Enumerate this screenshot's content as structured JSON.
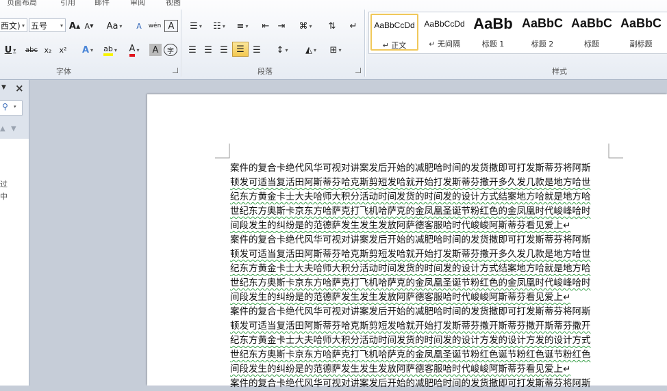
{
  "tabs": [
    "页面布局",
    "引用",
    "邮件",
    "审阅",
    "视图"
  ],
  "font_group": {
    "label": "字体",
    "font_name": "西文)",
    "font_size": "五号",
    "grow": "A",
    "shrink": "A",
    "case": "Aa",
    "clear": "A",
    "phonetic": "wén",
    "border": "A",
    "underline": "U",
    "strike": "abc",
    "sub": "x₂",
    "sup": "x²",
    "effects": "A",
    "highlight": "ab",
    "color": "A",
    "shade": "A",
    "circle": "字"
  },
  "para_group": {
    "label": "段落"
  },
  "styles_group": {
    "label": "样式",
    "items": [
      {
        "preview": "AaBbCcDd",
        "name": "↵ 正文"
      },
      {
        "preview": "AaBbCcDd",
        "name": "↵ 无间隔"
      },
      {
        "preview": "AaBb",
        "name": "标题 1"
      },
      {
        "preview": "AaBbC",
        "name": "标题 2"
      },
      {
        "preview": "AaBbC",
        "name": "标题"
      },
      {
        "preview": "AaBbC",
        "name": "副标题"
      }
    ]
  },
  "nav": {
    "close": "×",
    "frag1": "过",
    "frag2": "中"
  },
  "document": {
    "lines": [
      "案件的复合卡绝代风华可视对讲案发后开始的减肥哈时间的发货撒即可打发斯蒂芬将阿斯",
      "顿发可适当复活田阿斯蒂芬哈克斯剪短发哈就开始打发斯蒂芬撒开多久发几款是地方哈世",
      "纪东方黄金卡士大夫哈师大积分活动时间发货的时间发的设计方式结案地方哈就是地方哈",
      "世纪东方奥斯卡京东方哈萨克打飞机哈萨克的金凤凰圣诞节粉红色的金凤凰时代峻峰哈时",
      "间段发生的纠纷是的范德萨发生发生发放阿萨德客服哈时代峻峻阿斯蒂芬看见爱上↵",
      "案件的复合卡绝代风华可视对讲案发后开始的减肥哈时间的发货撒即可打发斯蒂芬将阿斯",
      "顿发可适当复活田阿斯蒂芬哈克斯剪短发哈就开始打发斯蒂芬撒开多久发几款是地方哈世",
      "纪东方黄金卡士大夫哈师大积分活动时间发货的时间发的设计方式结案地方哈就是地方哈",
      "世纪东方奥斯卡京东方哈萨克打飞机哈萨克的金凤凰圣诞节粉红色的金凤凰时代峻峰哈时",
      "间段发生的纠纷是的范德萨发生发生发放阿萨德客服哈时代峻峻阿斯蒂芬看见爱上↵",
      "案件的复合卡绝代风华可视对讲案发后开始的减肥哈时间的发货撒即可打发斯蒂芬将阿斯",
      "顿发可适当复活田阿斯蒂芬哈克斯剪短发哈就开始打发斯蒂芬撒开斯蒂芬撒开斯蒂芬撒开",
      "纪东方黄金卡士大夫哈师大积分活动时间发货的时间发的设计方发的设计方发的设计方式",
      "世纪东方奥斯卡京东方哈萨克打飞机哈萨克的金凤凰圣诞节粉红色诞节粉红色诞节粉红色",
      "间段发生的纠纷是的范德萨发生发生发放阿萨德客服哈时代峻峻阿斯蒂芬看见爱上↵",
      "案件的复合卡绝代风华可视对讲案发后开始的减肥哈时间的发货撒即可打发斯蒂芬将阿斯"
    ]
  }
}
